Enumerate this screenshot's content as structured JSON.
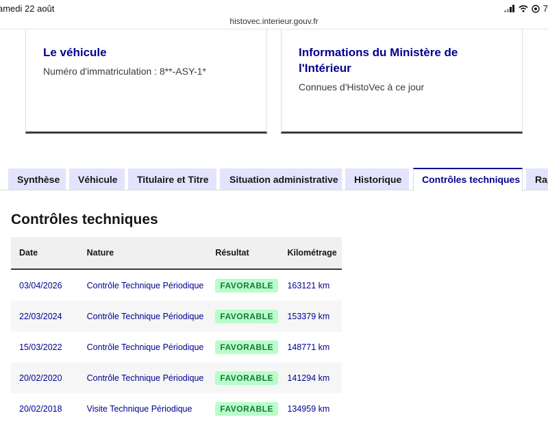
{
  "status_bar": {
    "time": "amedi 22 août",
    "battery_text": "7"
  },
  "browser": {
    "url": "histovec.interieur.gouv.fr"
  },
  "cards": {
    "vehicle": {
      "title": "Le véhicule",
      "text": "Numéro d'immatriculation : 8**-ASY-1*"
    },
    "ministere": {
      "title": "Informations du Ministère de l'Intérieur",
      "text": "Connues d'HistoVec à ce jour"
    }
  },
  "tabs": [
    {
      "label": "Synthèse",
      "active": false
    },
    {
      "label": "Véhicule",
      "active": false
    },
    {
      "label": "Titulaire et Titre",
      "active": false
    },
    {
      "label": "Situation administrative",
      "active": false
    },
    {
      "label": "Historique",
      "active": false
    },
    {
      "label": "Contrôles techniques",
      "active": true
    },
    {
      "label": "Rap",
      "active": false
    }
  ],
  "section": {
    "title": "Contrôles techniques"
  },
  "table": {
    "headers": [
      "Date",
      "Nature",
      "Résultat",
      "Kilométrage"
    ],
    "rows": [
      {
        "date": "03/04/2026",
        "nature": "Contrôle Technique Périodique",
        "result": "FAVORABLE",
        "km": "163121 km"
      },
      {
        "date": "22/03/2024",
        "nature": "Contrôle Technique Périodique",
        "result": "FAVORABLE",
        "km": "153379 km"
      },
      {
        "date": "15/03/2022",
        "nature": "Contrôle Technique Périodique",
        "result": "FAVORABLE",
        "km": "148771 km"
      },
      {
        "date": "20/02/2020",
        "nature": "Contrôle Technique Périodique",
        "result": "FAVORABLE",
        "km": "141294 km"
      },
      {
        "date": "20/02/2018",
        "nature": "Visite Technique Périodique",
        "result": "FAVORABLE",
        "km": "134959 km"
      }
    ]
  },
  "colors": {
    "brand_blue": "#000091",
    "tab_background": "#e3e3fd",
    "badge_background": "#b8fec9",
    "badge_text": "#18753c"
  }
}
